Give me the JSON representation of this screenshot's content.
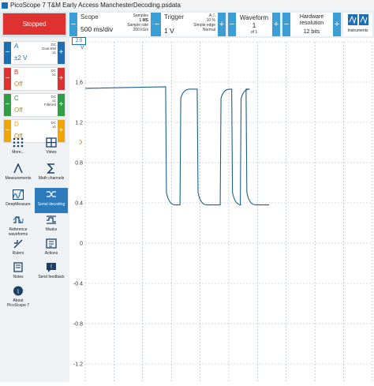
{
  "window": {
    "title": "PicoScope 7 T&M Early Access ManchesterDecoding.psdata"
  },
  "toolbar": {
    "run_label": "Stopped",
    "scope": {
      "title": "Scope",
      "value": "500 ms/div",
      "samples_label": "Samples",
      "samples_value": "1 MS",
      "rate_label": "Sample rate",
      "rate_value": "200 kS/s"
    },
    "trigger": {
      "title": "Trigger",
      "value": "1 V",
      "channel": "A",
      "pre": "10 %",
      "mode_label": "Simple edge",
      "mode_value": "Normal"
    },
    "waveform": {
      "title": "Waveform",
      "value": "1",
      "of_label": "of 1"
    },
    "resolution": {
      "title": "Hardware resolution",
      "value": "12 bits"
    },
    "instruments_label": "Instruments"
  },
  "channels": [
    {
      "name": "A",
      "value": "±2 V",
      "info1": "DC",
      "info2": "Dual BW",
      "info3": "x1",
      "color": "#1c6fb3",
      "on": true
    },
    {
      "name": "B",
      "value": "Off",
      "info1": "DC",
      "info2": "x1",
      "info3": "",
      "color": "#e03131",
      "on": false
    },
    {
      "name": "C",
      "value": "Off",
      "info1": "DC",
      "info2": "x1",
      "info3": "Filtered",
      "color": "#2f9e44",
      "on": false
    },
    {
      "name": "D",
      "value": "Off",
      "info1": "DC",
      "info2": "x1",
      "info3": "",
      "color": "#f0a500",
      "on": false
    }
  ],
  "tools": {
    "more": "More...",
    "views": "Views",
    "measurements": "Measurements",
    "math": "Math channels",
    "deepmeasure": "DeepMeasure",
    "serial": "Serial decoding",
    "reference": "Reference waveforms",
    "masks": "Masks",
    "rulers": "Rulers",
    "actions": "Actions",
    "notes": "Notes",
    "feedback": "Send feedback",
    "about": "About PicoScope 7"
  },
  "plot": {
    "axis_top": "2.0",
    "unit": "V",
    "ticks": [
      "1.6",
      "1.2",
      "0.8",
      "0.4",
      "0",
      "-0.4",
      "-0.8",
      "-1.2"
    ],
    "trace_color": "#1c5f8a",
    "trace": {
      "high_v": 1.53,
      "low_v": 0.38,
      "first_edge_div": 2.8,
      "levels_after_first": [
        "low",
        "high",
        "low",
        "high",
        "low",
        "high",
        "low"
      ],
      "segment_divs": [
        0.2,
        0.5,
        0.6,
        0.8,
        0.4,
        0.3,
        0.2,
        0.8,
        0.2,
        0.7,
        0.4
      ]
    }
  }
}
